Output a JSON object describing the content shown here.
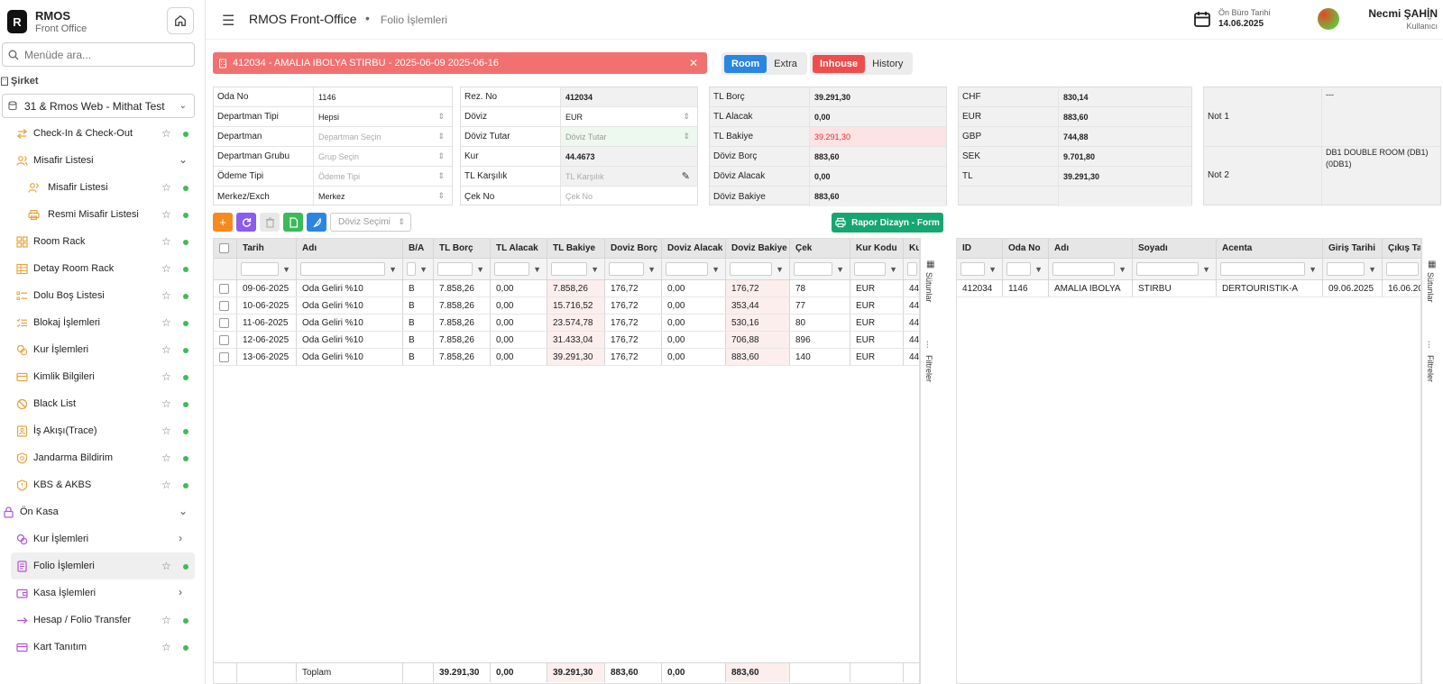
{
  "brand": {
    "logo_letter": "R",
    "title": "RMOS",
    "subtitle": "Front Office"
  },
  "sidebar": {
    "search_placeholder": "Menüde ara...",
    "company_label": "Şirket",
    "company_value": "31 & Rmos Web - Mithat Test",
    "items": [
      {
        "label": "Check-In & Check-Out",
        "icon": "swap-icon"
      },
      {
        "label": "Misafir Listesi",
        "icon": "users-icon"
      },
      {
        "label": "Misafir Listesi",
        "icon": "users-icon"
      },
      {
        "label": "Resmi Misafir Listesi",
        "icon": "printer-icon"
      },
      {
        "label": "Room Rack",
        "icon": "grid-icon"
      },
      {
        "label": "Detay Room Rack",
        "icon": "table-icon"
      },
      {
        "label": "Dolu Boş Listesi",
        "icon": "list-icon"
      },
      {
        "label": "Blokaj İşlemleri",
        "icon": "list-check-icon"
      },
      {
        "label": "Kur İşlemleri",
        "icon": "coins-icon"
      },
      {
        "label": "Kimlik Bilgileri",
        "icon": "id-card-icon"
      },
      {
        "label": "Black List",
        "icon": "ban-icon"
      },
      {
        "label": "İş Akışı(Trace)",
        "icon": "trace-icon"
      },
      {
        "label": "Jandarma Bildirim",
        "icon": "badge-icon"
      },
      {
        "label": "KBS & AKBS",
        "icon": "shield-icon"
      },
      {
        "label": "Ön Kasa",
        "icon": "lock-icon"
      },
      {
        "label": "Kur İşlemleri",
        "icon": "coins-icon"
      },
      {
        "label": "Folio İşlemleri",
        "icon": "document-icon"
      },
      {
        "label": "Kasa İşlemleri",
        "icon": "wallet-icon"
      },
      {
        "label": "Hesap / Folio Transfer",
        "icon": "arrow-right-icon"
      },
      {
        "label": "Kart Tanıtım",
        "icon": "card-icon"
      }
    ]
  },
  "topbar": {
    "app_title": "RMOS Front-Office",
    "separator": "•",
    "page_title": "Folio İşlemleri",
    "date_label": "Ön Büro Tarihi",
    "date_value": "14.06.2025",
    "user_name": "Necmi ŞAHİN",
    "user_role": "Kullanıcı"
  },
  "folio": {
    "header": "412034 - AMALIA IBOLYA STIRBU - 2025-06-09 2025-06-16",
    "toggle1": [
      "Room",
      "Extra"
    ],
    "toggle2": [
      "Inhouse",
      "History"
    ]
  },
  "panel1": [
    {
      "label": "Oda No",
      "value": "1146"
    },
    {
      "label": "Departman Tipi",
      "value": "Hepsi"
    },
    {
      "label": "Departman",
      "value": "Departman Seçin"
    },
    {
      "label": "Departman Grubu",
      "value": "Grup Seçin"
    },
    {
      "label": "Ödeme Tipi",
      "value": "Ödeme Tipi"
    },
    {
      "label": "Merkez/Exch",
      "value": "Merkez"
    }
  ],
  "panel2": [
    {
      "label": "Rez. No",
      "value": "412034"
    },
    {
      "label": "Döviz",
      "value": "EUR"
    },
    {
      "label": "Döviz Tutar",
      "value": "Döviz Tutar"
    },
    {
      "label": "Kur",
      "value": "44.4673"
    },
    {
      "label": "TL Karşılık",
      "value": "TL Karşılık"
    },
    {
      "label": "Çek No",
      "value": "Çek No"
    }
  ],
  "panel3": [
    {
      "label": "TL Borç",
      "value": "39.291,30"
    },
    {
      "label": "TL Alacak",
      "value": "0,00"
    },
    {
      "label": "TL Bakiye",
      "value": "39.291,30"
    },
    {
      "label": "Döviz Borç",
      "value": "883,60"
    },
    {
      "label": "Döviz Alacak",
      "value": "0,00"
    },
    {
      "label": "Döviz Bakiye",
      "value": "883,60"
    }
  ],
  "panel4": [
    {
      "label": "CHF",
      "value": "830,14"
    },
    {
      "label": "EUR",
      "value": "883,60"
    },
    {
      "label": "GBP",
      "value": "744,88"
    },
    {
      "label": "SEK",
      "value": "9.701,80"
    },
    {
      "label": "TL",
      "value": "39.291,30"
    }
  ],
  "panel5": {
    "note1_label": "Not 1",
    "note1_value": "---",
    "note2_label": "Not 2",
    "note2_value": "DB1 DOUBLE ROOM (DB1) (0DB1)"
  },
  "toolbar": {
    "currency_placeholder": "Döviz Seçimi",
    "report_button": "Rapor Dizayn - Form"
  },
  "grid1": {
    "headers": [
      "Tarih",
      "Adı",
      "B/A",
      "TL Borç",
      "TL Alacak",
      "TL Bakiye",
      "Doviz Borç",
      "Doviz Alacak",
      "Doviz Bakiye",
      "Çek",
      "Kur Kodu",
      "Ku"
    ],
    "rows": [
      [
        "09-06-2025",
        "Oda Geliri %10",
        "B",
        "7.858,26",
        "0,00",
        "7.858,26",
        "176,72",
        "0,00",
        "176,72",
        "78",
        "EUR",
        "44"
      ],
      [
        "10-06-2025",
        "Oda Geliri %10",
        "B",
        "7.858,26",
        "0,00",
        "15.716,52",
        "176,72",
        "0,00",
        "353,44",
        "77",
        "EUR",
        "44"
      ],
      [
        "11-06-2025",
        "Oda Geliri %10",
        "B",
        "7.858,26",
        "0,00",
        "23.574,78",
        "176,72",
        "0,00",
        "530,16",
        "80",
        "EUR",
        "44"
      ],
      [
        "12-06-2025",
        "Oda Geliri %10",
        "B",
        "7.858,26",
        "0,00",
        "31.433,04",
        "176,72",
        "0,00",
        "706,88",
        "896",
        "EUR",
        "44"
      ],
      [
        "13-06-2025",
        "Oda Geliri %10",
        "B",
        "7.858,26",
        "0,00",
        "39.291,30",
        "176,72",
        "0,00",
        "883,60",
        "140",
        "EUR",
        "44"
      ]
    ],
    "footer": {
      "label": "Toplam",
      "tl_borc": "39.291,30",
      "tl_alacak": "0,00",
      "tl_bakiye": "39.291,30",
      "doviz_borc": "883,60",
      "doviz_alacak": "0,00",
      "doviz_bakiye": "883,60"
    }
  },
  "grid2": {
    "headers": [
      "ID",
      "Oda No",
      "Adı",
      "Soyadı",
      "Acenta",
      "Giriş Tarihi",
      "Çıkış Ta"
    ],
    "rows": [
      [
        "412034",
        "1146",
        "AMALIA IBOLYA",
        "STIRBU",
        "DERTOURISTIK-A",
        "09.06.2025",
        "16.06.20"
      ]
    ]
  },
  "side_tabs": {
    "columns": "Sütunlar",
    "filters": "Filtreler"
  },
  "colors": {
    "accent_blue": "#2a86e0",
    "danger": "#ef4c4c",
    "banner": "#f17171",
    "success": "#16a673",
    "orange": "#f58a1f",
    "purple": "#8a5cf0",
    "green": "#3cb95a"
  }
}
